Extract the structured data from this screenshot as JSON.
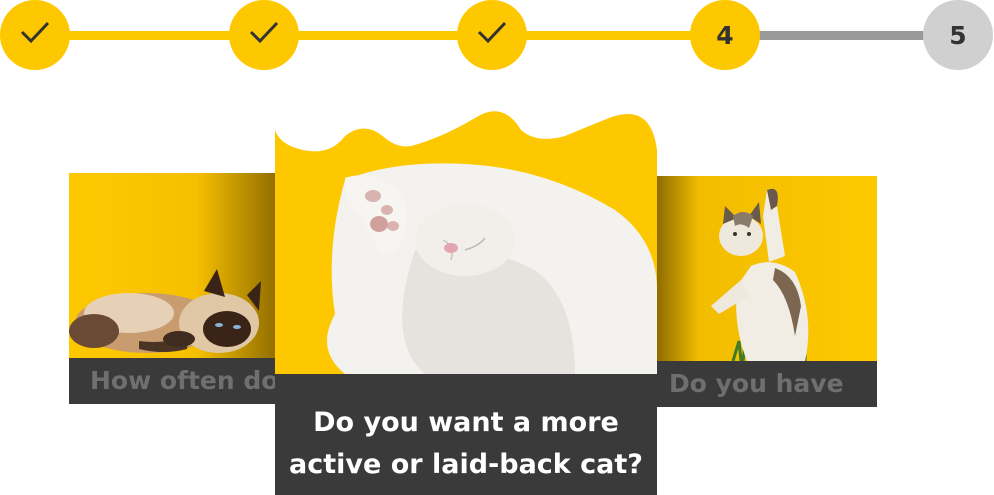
{
  "colors": {
    "accent": "#fec800",
    "track_done": "#fec800",
    "track_pending": "#999999",
    "step_pending": "#d0d0d0",
    "caption_bg": "#3a3a3a"
  },
  "stepper": {
    "steps": [
      {
        "status": "done",
        "icon": "check-icon"
      },
      {
        "status": "done",
        "icon": "check-icon"
      },
      {
        "status": "done",
        "icon": "check-icon"
      },
      {
        "status": "current",
        "label": "4"
      },
      {
        "status": "pending",
        "label": "5"
      }
    ]
  },
  "cards": {
    "left": {
      "caption": "How often do",
      "image": "cat-lying-down"
    },
    "center": {
      "caption_line1": "Do you want a more",
      "caption_line2": "active or laid-back cat?",
      "image": "white-cat-covering-face"
    },
    "right": {
      "caption": "Do you have",
      "image": "cat-standing-paw-up"
    }
  }
}
